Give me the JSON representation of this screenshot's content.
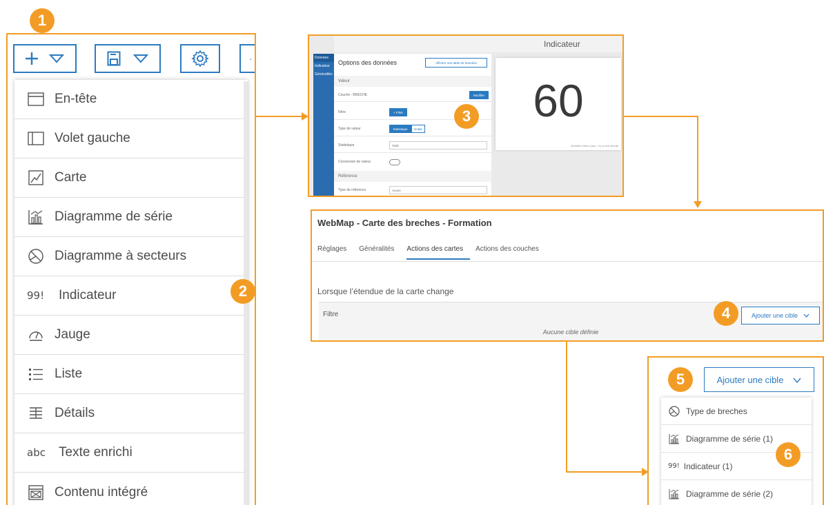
{
  "badges": [
    "1",
    "2",
    "3",
    "4",
    "5",
    "6"
  ],
  "colors": {
    "accent_orange": "#f39c25",
    "blue": "#2b7ac0",
    "sidebar_blue": "#2b6cb0"
  },
  "toolbar": {
    "add_icon": "plus-icon",
    "add_dropdown_icon": "chevron-down-icon",
    "save_icon": "save-icon",
    "save_dropdown_icon": "chevron-down-icon",
    "settings_icon": "gear-icon"
  },
  "menu": {
    "items": [
      {
        "label": "En-tête",
        "icon": "header-icon"
      },
      {
        "label": "Volet gauche",
        "icon": "side-panel-icon"
      },
      {
        "label": "Carte",
        "icon": "map-icon"
      },
      {
        "label": "Diagramme de série",
        "icon": "serial-chart-icon"
      },
      {
        "label": "Diagramme à secteurs",
        "icon": "pie-chart-icon"
      },
      {
        "label": "Indicateur",
        "icon_text": "99!"
      },
      {
        "label": "Jauge",
        "icon": "gauge-icon"
      },
      {
        "label": "Liste",
        "icon": "list-icon"
      },
      {
        "label": "Détails",
        "icon": "details-icon"
      },
      {
        "label": "Texte enrichi",
        "icon_text": "abc"
      },
      {
        "label": "Contenu intégré",
        "icon": "embedded-content-icon"
      }
    ]
  },
  "indicator_panel": {
    "window_title": "Indicateur",
    "sidebar": [
      "Données",
      "Indicateur",
      "Généralités"
    ],
    "heading": "Options des données",
    "table_button": "Afficher une table de données",
    "section_value": "Valeur",
    "layer": "Couche : BRECHE",
    "modify_button": "Modifier",
    "filter_label": "Filtre",
    "filter_button": "+ Filtre",
    "value_type_label": "Type de valeur",
    "value_type_options": [
      "Statistique",
      "Entité"
    ],
    "statistic_label": "Statistique",
    "statistic_value": "Total",
    "conversion_label": "Conversion de valeur",
    "section_reference": "Référence",
    "reference_type_label": "Type de référence",
    "reference_type_value": "Aucun",
    "value": "60",
    "last_update": "Dernière mise à jour : il y a une minute"
  },
  "webmap_panel": {
    "title": "WebMap - Carte des breches - Formation",
    "tabs": [
      {
        "label": "Réglages",
        "active": false
      },
      {
        "label": "Généralités",
        "active": false
      },
      {
        "label": "Actions des cartes",
        "active": true
      },
      {
        "label": "Actions des couches",
        "active": false
      }
    ],
    "when_label": "Lorsque l’étendue de la carte change",
    "filter_label": "Filtre",
    "add_target": "Ajouter une cible",
    "no_target": "Aucune cible définie"
  },
  "dropdown_panel": {
    "add_target": "Ajouter une cible",
    "items": [
      {
        "label": "Type de breches",
        "icon": "pie-chart-icon"
      },
      {
        "label": "Diagramme de série (1)",
        "icon": "serial-chart-icon"
      },
      {
        "label": "Indicateur (1)",
        "icon_text": "99!"
      },
      {
        "label": "Diagramme de série (2)",
        "icon": "serial-chart-icon"
      }
    ]
  }
}
